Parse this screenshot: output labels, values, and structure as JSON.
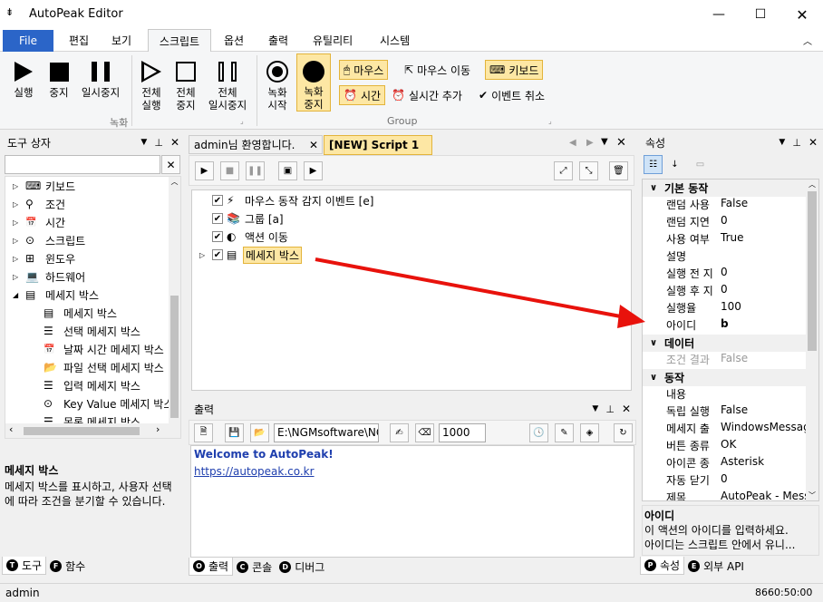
{
  "app": {
    "title": "AutoPeak Editor"
  },
  "menu": {
    "file": "File",
    "items": [
      "편집",
      "보기",
      "스크립트",
      "옵션",
      "출력",
      "유틸리티",
      "시스템"
    ]
  },
  "ribbon": {
    "record": {
      "run": "실행",
      "stop": "중지",
      "pause": "일시중지",
      "label": "녹화"
    },
    "all": {
      "run1": "전체",
      "run2": "실행",
      "stop1": "전체",
      "stop2": "중지",
      "pause1": "전체",
      "pause2": "일시중지"
    },
    "rec": {
      "start1": "녹화",
      "start2": "시작",
      "stop1": "녹화",
      "stop2": "중지"
    },
    "group": {
      "mouse": "마우스",
      "mouse_move": "마우스 이동",
      "keyboard": "키보드",
      "time": "시간",
      "realtime": "실시간 추가",
      "event_cancel": "이벤트 취소",
      "label": "Group"
    }
  },
  "toolbox": {
    "title": "도구 상자",
    "search": "",
    "items": [
      {
        "label": "키보드"
      },
      {
        "label": "조건"
      },
      {
        "label": "시간"
      },
      {
        "label": "스크립트"
      },
      {
        "label": "윈도우"
      },
      {
        "label": "하드웨어"
      },
      {
        "label": "메세지 박스"
      }
    ],
    "sub": [
      "메세지 박스",
      "선택 메세지 박스",
      "날짜 시간 메세지 박스",
      "파일 선택 메세지 박스",
      "입력 메세지 박스",
      "Key Value 메세지 박스",
      "목록 메세지 박스"
    ],
    "desc_title": "메세지 박스",
    "desc_text": "메세지 박스를 표시하고, 사용자 선택에 따라 조건을 분기할 수 있습니다.",
    "tabs": [
      "도구",
      "함수"
    ]
  },
  "editor": {
    "tabs": [
      "admin님 환영합니다.",
      "[NEW] Script 1"
    ],
    "items": [
      "마우스 동작 감지 이벤트 [e]",
      "그룹 [a]",
      "액션 이동",
      "메세지 박스"
    ]
  },
  "output": {
    "title": "출력",
    "path": "E:\\NGMsoftware\\NG",
    "count": "1000",
    "line1": "Welcome to AutoPeak!",
    "line2": "https://autopeak.co.kr",
    "tabs": [
      "출력",
      "콘솔",
      "디버그"
    ]
  },
  "props": {
    "title": "속성",
    "cats": [
      {
        "name": "기본 동작",
        "rows": [
          [
            "랜덤 사용",
            "False"
          ],
          [
            "랜덤 지연",
            "0"
          ],
          [
            "사용 여부",
            "True"
          ],
          [
            "설명",
            ""
          ],
          [
            "실행 전 지",
            "0"
          ],
          [
            "실행 후 지",
            "0"
          ],
          [
            "실행율",
            "100"
          ],
          [
            "아이디",
            "b"
          ]
        ]
      },
      {
        "name": "데이터",
        "rows": [
          [
            "조건 결과",
            "False"
          ]
        ]
      },
      {
        "name": "동작",
        "rows": [
          [
            "내용",
            ""
          ],
          [
            "독립 실행",
            "False"
          ],
          [
            "메세지 출",
            "WindowsMessage"
          ],
          [
            "버튼 종류",
            "OK"
          ],
          [
            "아이콘 종",
            "Asterisk"
          ],
          [
            "자동 닫기",
            "0"
          ],
          [
            "제목",
            "AutoPeak - Messa"
          ]
        ]
      }
    ],
    "desc_title": "아이디",
    "desc1": "이 액션의 아이디를 입력하세요.",
    "desc2": "아이디는 스크립트 안에서 유니...",
    "tabs": [
      "속성",
      "외부 API"
    ]
  },
  "status": {
    "user": "admin",
    "time": "8660:50:00"
  },
  "colors": {
    "accent": "#2b65c8",
    "arrow": "#e8120c",
    "highlight": "#fde7a4"
  }
}
